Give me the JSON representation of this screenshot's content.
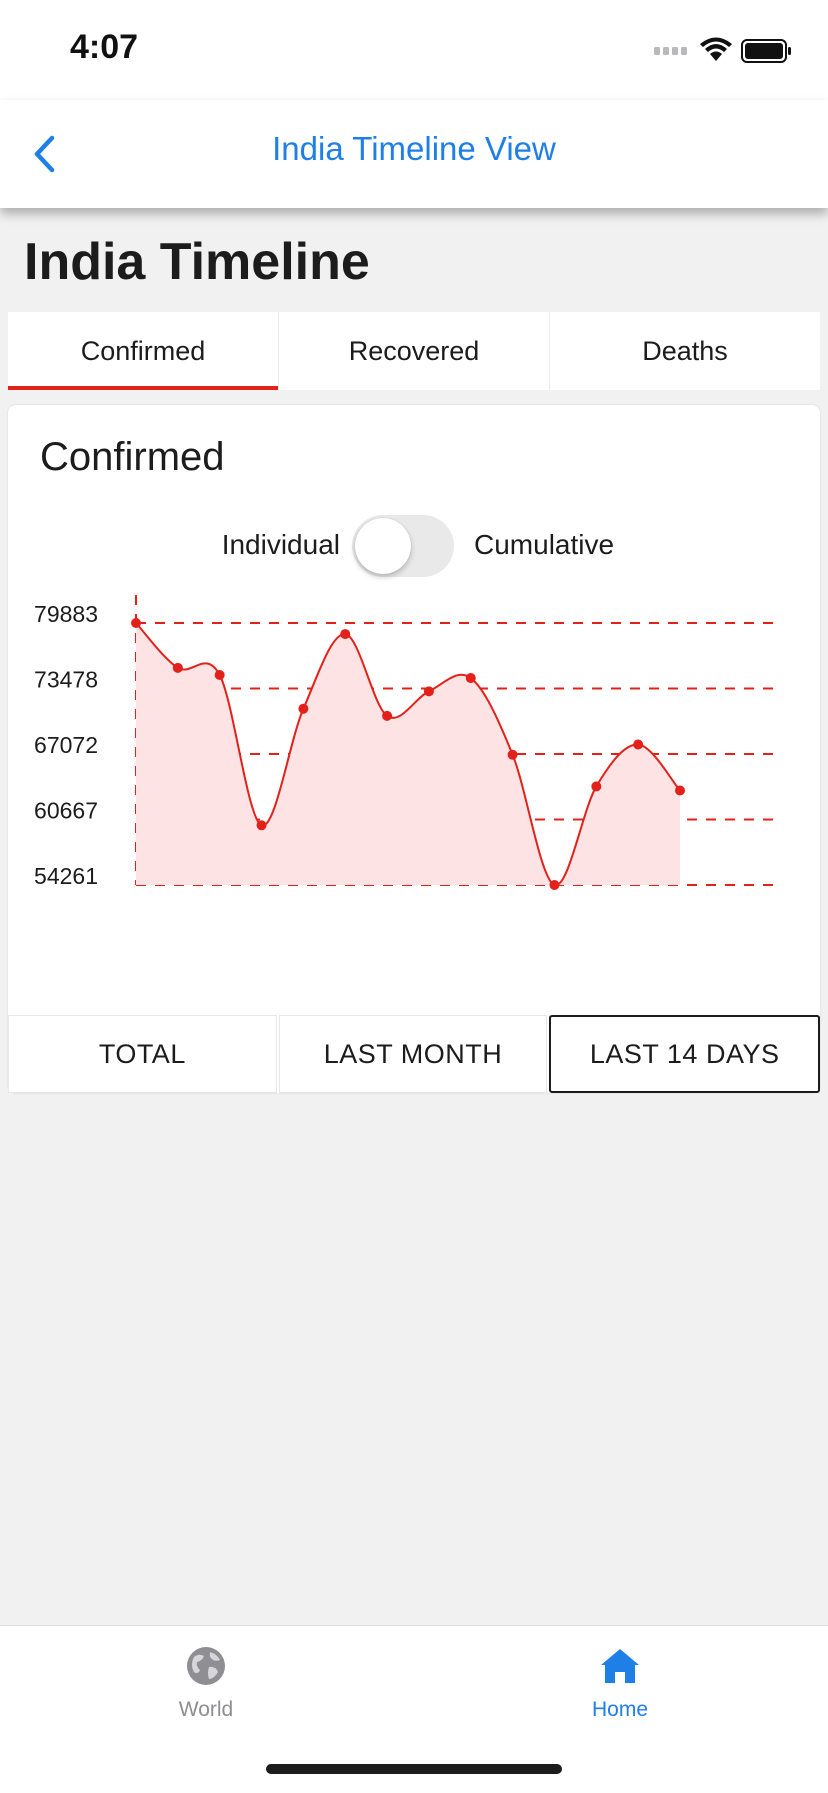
{
  "status_bar": {
    "time": "4:07"
  },
  "nav": {
    "title": "India Timeline View"
  },
  "page": {
    "heading": "India Timeline"
  },
  "tabs": [
    {
      "label": "Confirmed",
      "active": true
    },
    {
      "label": "Recovered",
      "active": false
    },
    {
      "label": "Deaths",
      "active": false
    }
  ],
  "card": {
    "title": "Confirmed",
    "toggle": {
      "left_label": "Individual",
      "right_label": "Cumulative",
      "on": false
    }
  },
  "chart_data": {
    "type": "area",
    "y_ticks": [
      "79883",
      "73478",
      "67072",
      "60667",
      "54261"
    ],
    "ylim": [
      54261,
      79883
    ],
    "grid": true,
    "color": "#e3211b",
    "fill": "#fde3e3",
    "series": [
      {
        "values": [
          79883,
          75500,
          74800,
          60100,
          71500,
          78800,
          70800,
          73200,
          74500,
          67000,
          54261,
          63900,
          68000,
          63500
        ]
      }
    ]
  },
  "range_buttons": [
    {
      "label": "TOTAL",
      "selected": false
    },
    {
      "label": "LAST MONTH",
      "selected": false
    },
    {
      "label": "LAST 14 DAYS",
      "selected": true
    }
  ],
  "tab_bar": {
    "items": [
      {
        "label": "World",
        "icon": "globe-icon",
        "color": "#8e8e93"
      },
      {
        "label": "Home",
        "icon": "house-icon",
        "color": "#1e7fe6"
      }
    ]
  }
}
